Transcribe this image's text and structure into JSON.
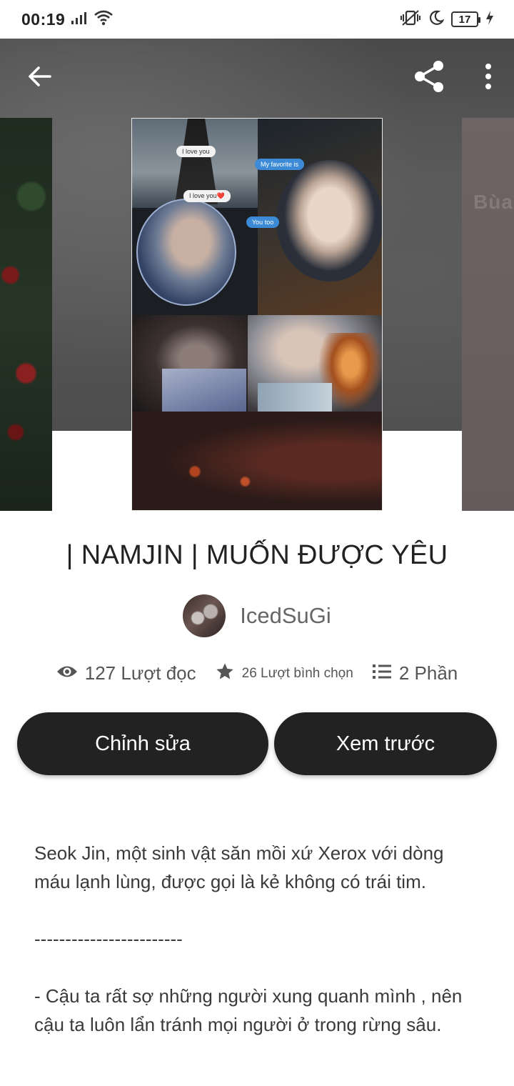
{
  "status_bar": {
    "time": "00:19",
    "battery_level": "17",
    "icons": [
      "signal-icon",
      "wifi-icon",
      "vibrate-icon",
      "moon-icon",
      "battery-icon",
      "charging-icon"
    ]
  },
  "top_bar": {
    "icons": [
      "back-arrow-icon",
      "share-icon",
      "more-vertical-icon"
    ]
  },
  "covers": {
    "right_partial_text": "Bùa",
    "main_bubbles": [
      "I love you",
      "My favorite is",
      "I love you❤️",
      "You too"
    ]
  },
  "story": {
    "title": "| NAMJIN | MUỐN ĐƯỢC YÊU",
    "author": "IcedSuGi"
  },
  "stats": {
    "reads": "127 Lượt đọc",
    "votes": "26 Lượt bình chọn",
    "parts": "2 Phần"
  },
  "buttons": {
    "edit": "Chỉnh sửa",
    "preview": "Xem trước"
  },
  "description": {
    "paragraphs": [
      "Seok Jin, một sinh vật săn mồi xứ Xerox với dòng máu lạnh lùng, được gọi là kẻ không có trái tim.",
      "------------------------",
      "- Cậu ta rất sợ những người xung quanh mình , nên cậu ta luôn lẩn tránh mọi người ở trong rừng sâu."
    ]
  },
  "colors": {
    "button_bg": "#222222",
    "button_text": "#ffffff",
    "title_text": "#222222",
    "muted_text": "#555555"
  }
}
